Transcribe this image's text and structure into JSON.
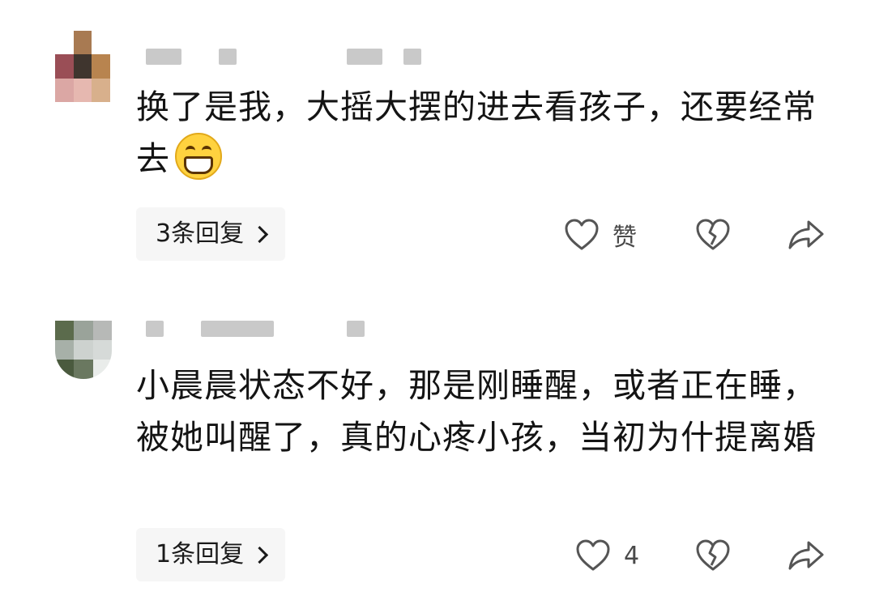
{
  "comments": [
    {
      "text": "换了是我，大摇大摆的进去看孩子，还要经常去",
      "emoji": "grin-icon",
      "replies_label": "3条回复",
      "like_label": "赞"
    },
    {
      "text": "小晨晨状态不好，那是刚睡醒，或者正在睡，被她叫醒了，真的心疼小孩，当初为什提离婚",
      "replies_label": "1条回复",
      "like_label": "4"
    }
  ],
  "colors": {
    "text": "#141414",
    "reply_pill": "#f6f6f6",
    "icon_stroke": "#555555"
  }
}
